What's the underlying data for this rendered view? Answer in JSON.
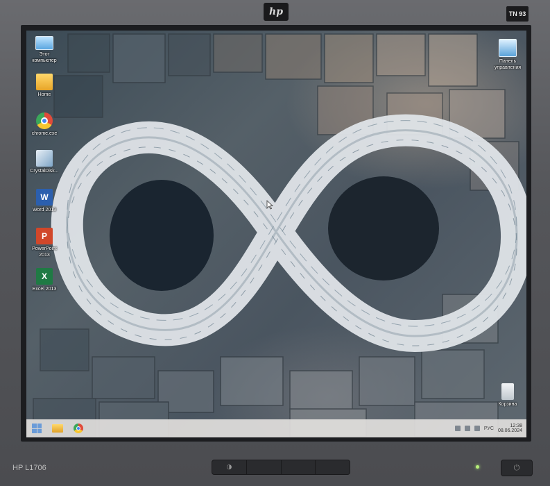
{
  "monitor": {
    "brand_logo": "hp",
    "model": "HP L1706",
    "badge": "TN 93",
    "front_buttons": [
      "◑",
      "",
      "",
      ""
    ],
    "power_symbol": "⏻"
  },
  "desktop": {
    "icons_left": [
      {
        "name": "this-pc",
        "label": "Этот компьютер",
        "icon": "computer-icon"
      },
      {
        "name": "home-folder",
        "label": "Home",
        "icon": "folder-icon"
      },
      {
        "name": "chrome",
        "label": "chrome.exe",
        "icon": "chrome-icon"
      },
      {
        "name": "crystaldisk",
        "label": "CrystalDisk...",
        "icon": "crystaldisk-icon"
      },
      {
        "name": "word",
        "label": "Word 2013",
        "icon": "word-icon",
        "glyph": "W"
      },
      {
        "name": "powerpoint",
        "label": "PowerPoint 2013",
        "icon": "powerpoint-icon",
        "glyph": "P"
      },
      {
        "name": "excel",
        "label": "Excel 2013",
        "icon": "excel-icon",
        "glyph": "X"
      }
    ],
    "icons_right": [
      {
        "name": "control-panel",
        "label": "Панель управления",
        "icon": "control-panel-icon"
      },
      {
        "name": "recycle-bin",
        "label": "Корзина",
        "icon": "recycle-bin-icon"
      }
    ],
    "wallpaper": "infinity-sculpture"
  },
  "taskbar": {
    "pinned": [
      {
        "name": "start-button",
        "icon": "windows-icon"
      },
      {
        "name": "explorer",
        "icon": "file-explorer-icon"
      },
      {
        "name": "chrome",
        "icon": "chrome-icon"
      }
    ],
    "language": "РУС",
    "time": "12:38",
    "date": "08.06.2024"
  },
  "colors": {
    "taskbar_bg": "#e1dedc",
    "start_accent": "#6a9bd8",
    "power_led": "#b7f07a"
  }
}
